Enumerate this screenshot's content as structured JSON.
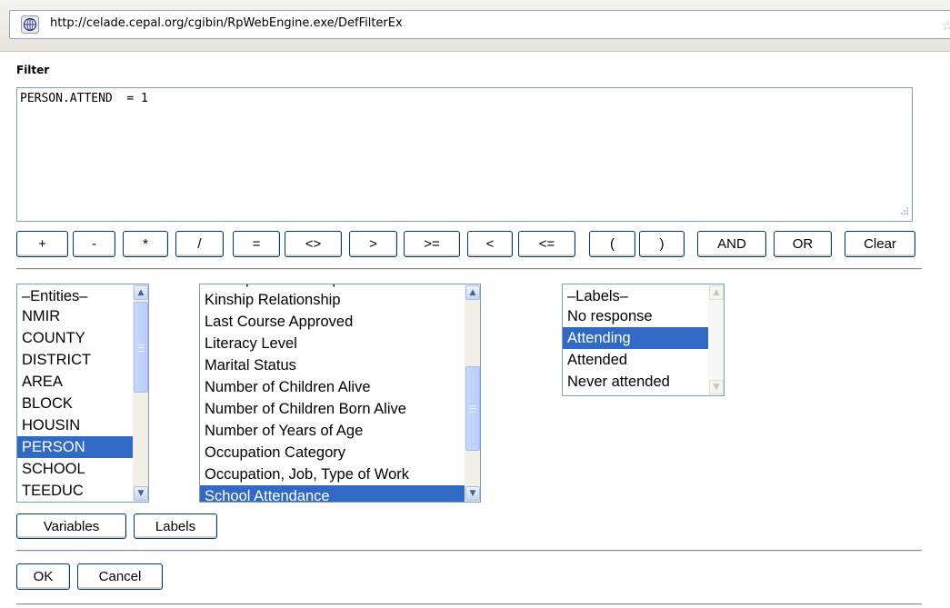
{
  "browser": {
    "url": "http://celade.cepal.org/cgibin/RpWebEngine.exe/DefFilterEx"
  },
  "filter": {
    "label": "Filter",
    "expression": "PERSON.ATTEND  = 1"
  },
  "operators": {
    "plus": "+",
    "minus": "-",
    "multiply": "*",
    "divide": "/",
    "equals": "=",
    "not_equal": "<>",
    "greater": ">",
    "greater_equal": ">=",
    "less": "<",
    "less_equal": "<=",
    "open_paren": "(",
    "close_paren": ")",
    "and": "AND",
    "or": "OR",
    "clear": "Clear"
  },
  "entities": {
    "header": "–Entities–",
    "items": [
      "NMIR",
      "COUNTY",
      "DISTRICT",
      "AREA",
      "BLOCK",
      "HOUSIN",
      "PERSON",
      "SCHOOL",
      "TEEDUC"
    ],
    "selected": "PERSON"
  },
  "variables": {
    "items": [
      "Kinship Relationship",
      "Last Course Approved",
      "Literacy Level",
      "Marital Status",
      "Number of Children Alive",
      "Number of Children Born Alive",
      "Number of Years of Age",
      "Occupation Category",
      "Occupation, Job, Type of Work",
      "School Attendance"
    ],
    "selected": "School Attendance"
  },
  "labels": {
    "header": "–Labels–",
    "items": [
      "No response",
      "Attending",
      "Attended",
      "Never attended"
    ],
    "selected": "Attending"
  },
  "buttons": {
    "variables": "Variables",
    "labels": "Labels",
    "ok": "OK",
    "cancel": "Cancel"
  }
}
